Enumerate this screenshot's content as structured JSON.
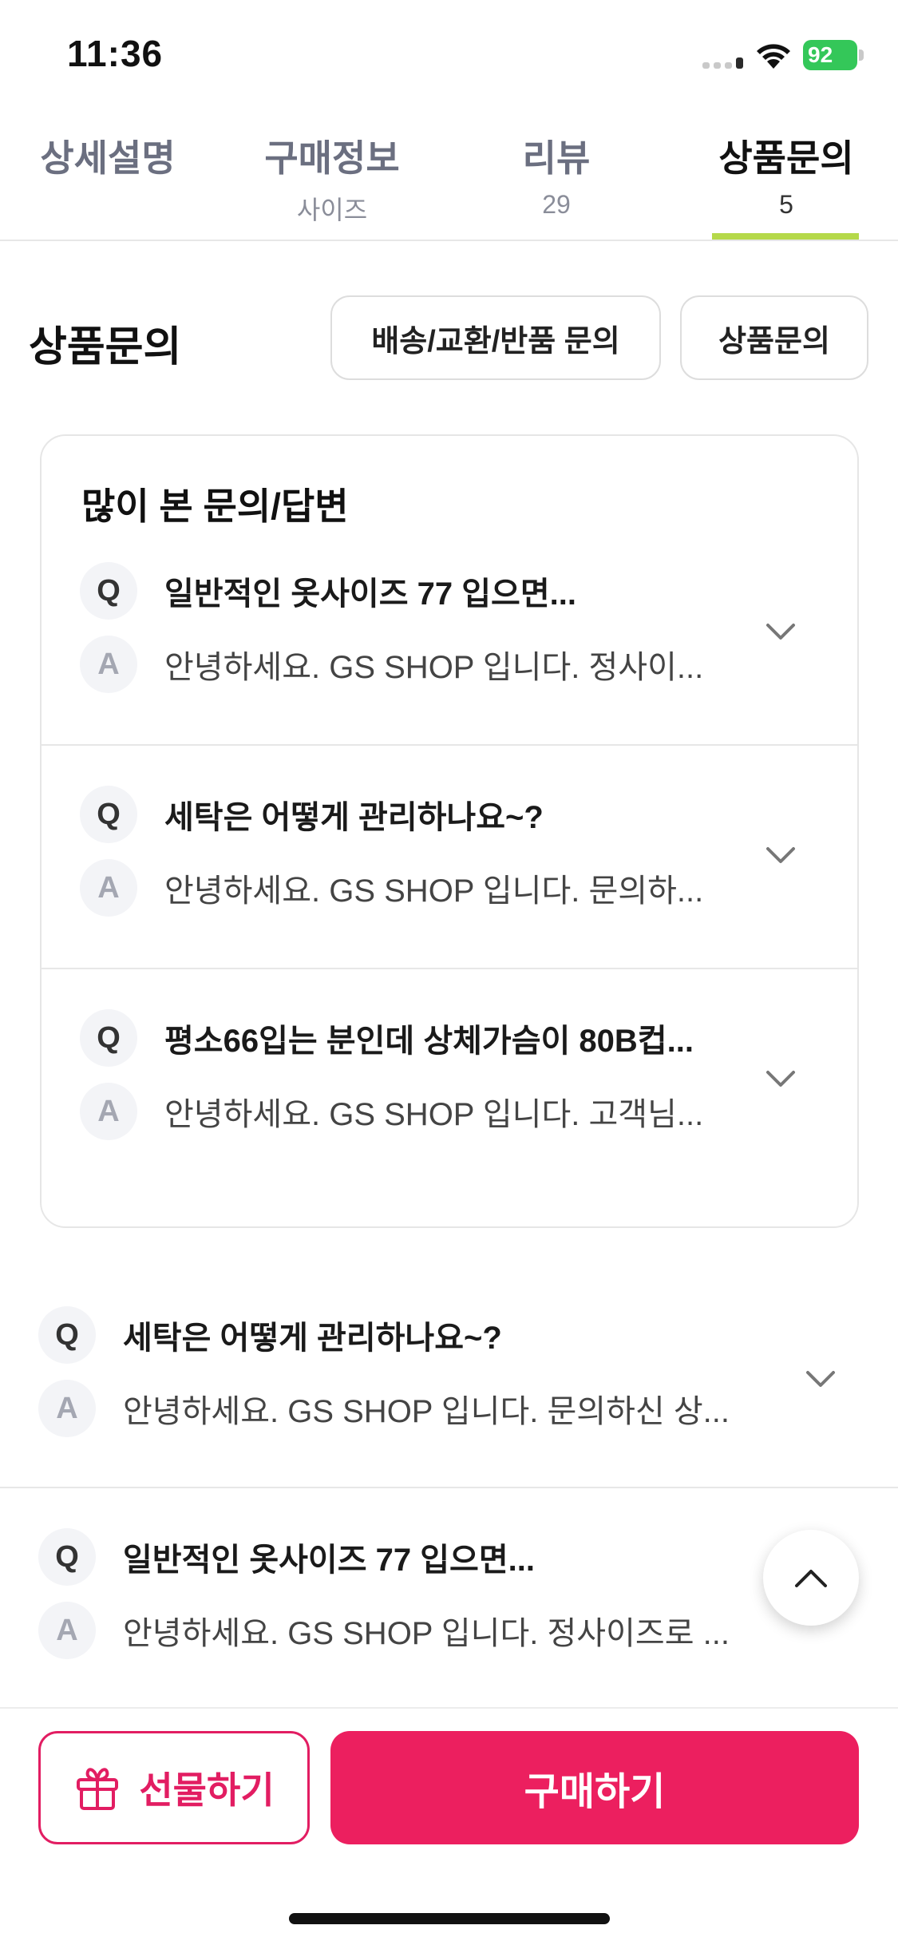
{
  "status_bar": {
    "time": "11:36",
    "battery": "92"
  },
  "tabs": [
    {
      "label": "상세설명",
      "sub": ""
    },
    {
      "label": "구매정보",
      "sub": "사이즈"
    },
    {
      "label": "리뷰",
      "sub": "29"
    },
    {
      "label": "상품문의",
      "sub": "5"
    }
  ],
  "active_tab": "상품문의",
  "section": {
    "title": "상품문의",
    "chip_shipping": "배송/교환/반품 문의",
    "chip_product": "상품문의"
  },
  "popular": {
    "title": "많이 본 문의/답변",
    "items": [
      {
        "q": "일반적인 옷사이즈 77 입으면...",
        "a": "안녕하세요. GS SHOP 입니다.  정사이..."
      },
      {
        "q": "세탁은 어떻게 관리하나요~?",
        "a": "안녕하세요. GS SHOP 입니다.  문의하..."
      },
      {
        "q": "평소66입는 분인데 상체가슴이 80B컵...",
        "a": "안녕하세요. GS SHOP 입니다.  고객님..."
      }
    ]
  },
  "list": [
    {
      "q": "세탁은 어떻게 관리하나요~?",
      "a": "안녕하세요. GS SHOP 입니다.  문의하신 상..."
    },
    {
      "q": "일반적인 옷사이즈 77 입으면...",
      "a": "안녕하세요. GS SHOP 입니다.  정사이즈로 ..."
    }
  ],
  "badges": {
    "q": "Q",
    "a": "A"
  },
  "bottom": {
    "gift": "선물하기",
    "buy": "구매하기"
  },
  "colors": {
    "accent": "#ec1f5f",
    "tab_underline": "#b5d94a",
    "battery": "#34c759"
  }
}
